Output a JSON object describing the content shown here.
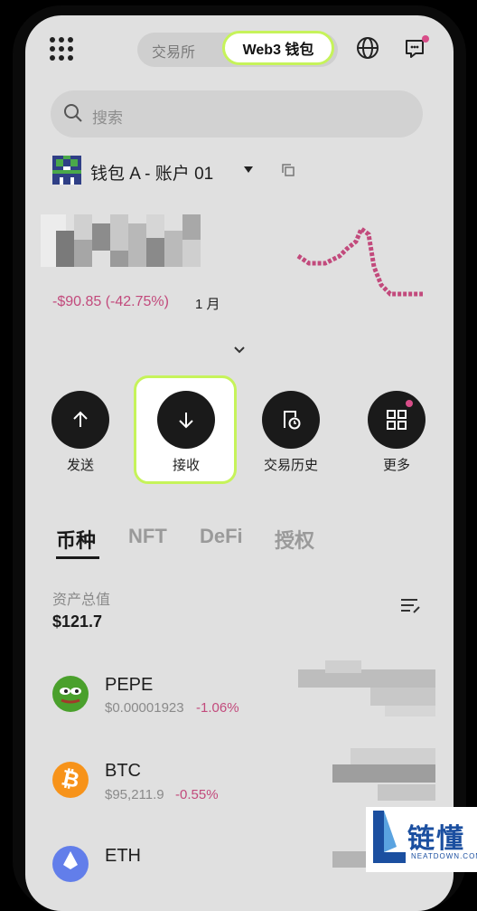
{
  "topbar": {
    "exchange_tab": "交易所",
    "web3_tab": "Web3 钱包"
  },
  "search": {
    "placeholder": "搜索"
  },
  "account": {
    "name": "钱包 A - 账户 01"
  },
  "balance": {
    "change": "-$90.85 (-42.75%)",
    "period": "1 月"
  },
  "actions": [
    {
      "label": "发送"
    },
    {
      "label": "接收"
    },
    {
      "label": "交易历史"
    },
    {
      "label": "更多"
    }
  ],
  "tabs": [
    {
      "label": "币种"
    },
    {
      "label": "NFT"
    },
    {
      "label": "DeFi"
    },
    {
      "label": "授权"
    }
  ],
  "assets": {
    "total_label": "资产总值",
    "total_value": "$121.7"
  },
  "coins": [
    {
      "name": "PEPE",
      "price": "$0.00001923",
      "change": "-1.06%"
    },
    {
      "name": "BTC",
      "price": "$95,211.9",
      "change": "-0.55%"
    },
    {
      "name": "ETH"
    }
  ],
  "colors": {
    "accent_green": "#c6f35a",
    "negative_pink": "#c24a7c",
    "pepe": "#4aa02c",
    "btc": "#f7931a",
    "eth": "#627eea"
  },
  "watermark": {
    "brand": "链懂",
    "domain": "NEATDOWN.COM"
  }
}
